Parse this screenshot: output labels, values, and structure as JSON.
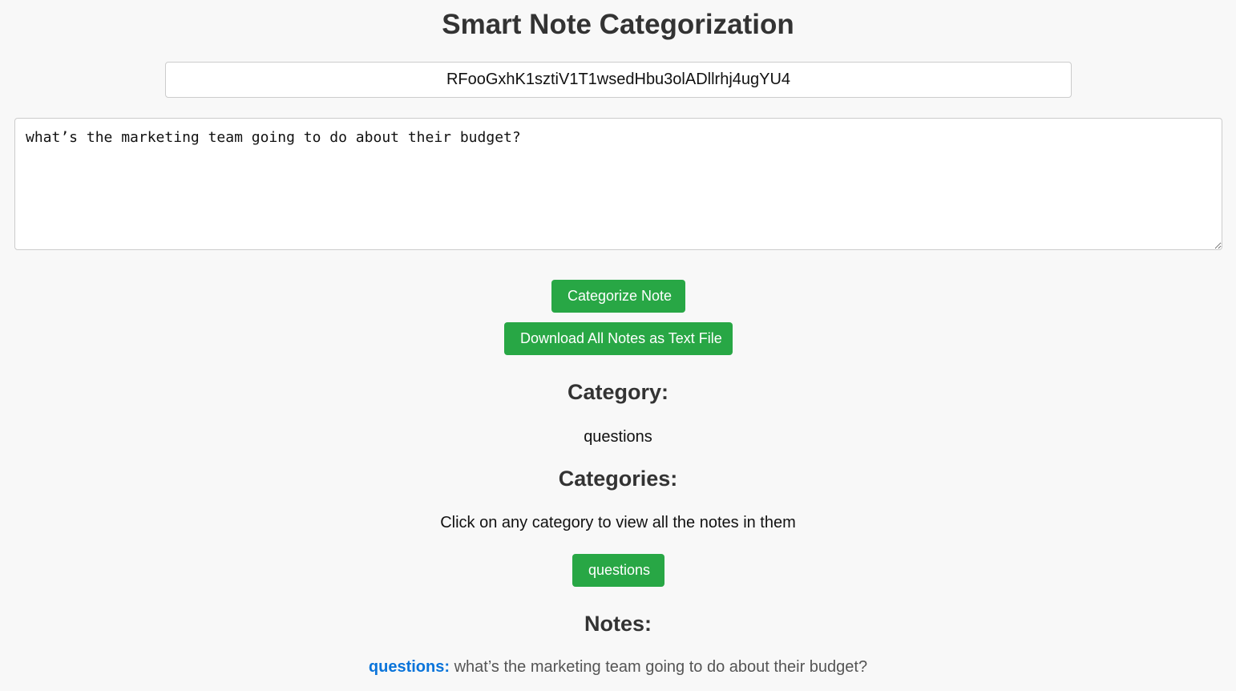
{
  "header": {
    "title": "Smart Note Categorization"
  },
  "api_key": {
    "value": "RFooGxhK1sztiV1T1wsedHbu3olADllrhj4ugYU4"
  },
  "note_input": {
    "value": "what’s the marketing team going to do about their budget?"
  },
  "actions": {
    "categorize_label": "Categorize Note",
    "download_label": "Download All Notes as Text File"
  },
  "result": {
    "heading": "Category:",
    "category": "questions"
  },
  "categories": {
    "heading": "Categories:",
    "hint": "Click on any category to view all the notes in them",
    "items": [
      {
        "label": "questions"
      }
    ]
  },
  "notes": {
    "heading": "Notes:",
    "items": [
      {
        "category": "questions:",
        "text": "what’s the marketing team going to do about their budget?"
      }
    ]
  },
  "colors": {
    "button_green": "#28a745",
    "note_category_blue": "#0a74da",
    "background": "#f8f8f8"
  }
}
